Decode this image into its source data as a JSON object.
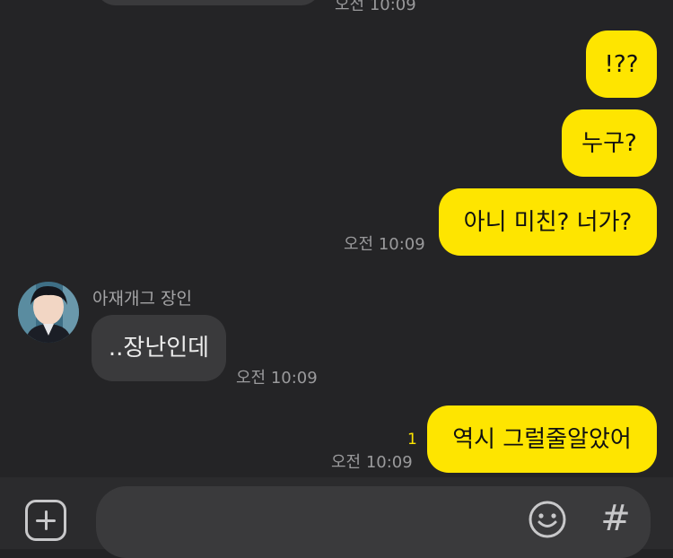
{
  "messages": {
    "top_time": "오전 10:09",
    "m1": "!??",
    "m2": "누구?",
    "m3": "아니 미친? 너가?",
    "m3_time": "오전 10:09",
    "sender_name": "아재개그 장인",
    "m4": "..장난인데",
    "m4_time": "오전 10:09",
    "m5": "역시 그럴줄알았어",
    "m5_unread": "1",
    "m5_time": "오전 10:09"
  },
  "composer": {
    "add_icon": "plus-square-icon",
    "emoji_icon": "smiley-icon",
    "hash_label": "#"
  },
  "colors": {
    "background": "#242426",
    "my_bubble": "#FEE500",
    "their_bubble": "#3A3A3C",
    "composer_bar": "#2B2B2D"
  }
}
